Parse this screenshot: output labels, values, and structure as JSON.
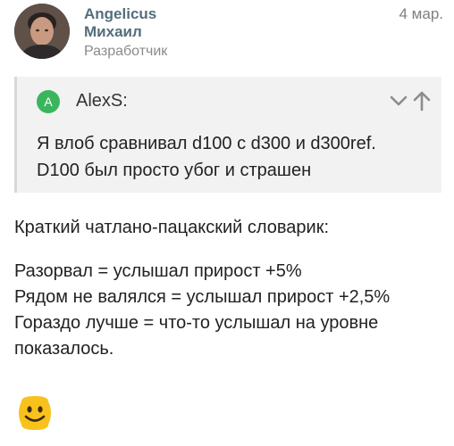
{
  "author": {
    "name_line1": "Angelicus",
    "name_line2": "Михаил",
    "role": "Разработчик",
    "avatar_icon": "avatar-photo"
  },
  "post": {
    "date": "4 мар."
  },
  "quote": {
    "badge_letter": "A",
    "badge_color": "#3bb55d",
    "author": "AlexS:",
    "line1": "Я влоб сравнивал d100 с d300 и d300ref.",
    "line2": "D100 был просто убог и страшен",
    "collapse_icon": "chevron-down-icon",
    "goto_icon": "arrow-up-icon"
  },
  "body": {
    "line1": "Краткий чатлано-пацакский словарик:",
    "line2": "Разорвал = услышал прирост +5%",
    "line3": "Рядом не валялся = услышал прирост +2,5%",
    "line4": "Гораздо лучше = что-то услышал на уровне",
    "line5": "показалось.",
    "emoji_icon": "smiley-icon"
  }
}
